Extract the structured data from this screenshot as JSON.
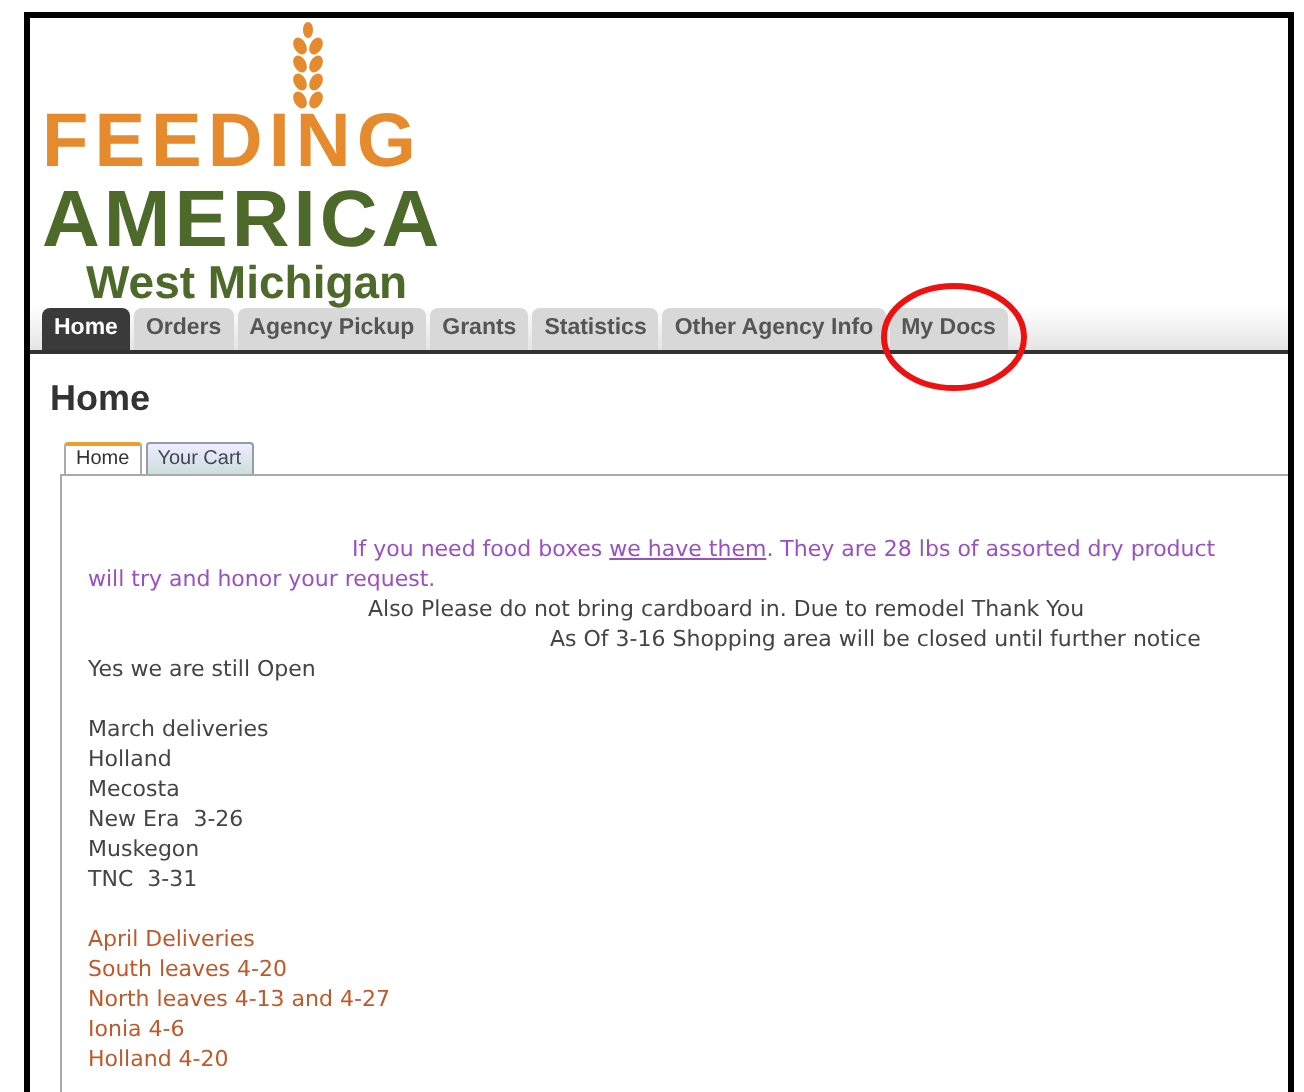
{
  "logo": {
    "line_1": "FEEDING",
    "line_2": "AMERICA",
    "line_3": "West Michigan"
  },
  "nav_tabs": [
    {
      "label": "Home",
      "selected": true
    },
    {
      "label": "Orders",
      "selected": false
    },
    {
      "label": "Agency Pickup",
      "selected": false
    },
    {
      "label": "Grants",
      "selected": false
    },
    {
      "label": "Statistics",
      "selected": false
    },
    {
      "label": "Other Agency Info",
      "selected": false
    },
    {
      "label": "My Docs",
      "selected": false
    }
  ],
  "page_title": "Home",
  "content_tabs": [
    {
      "label": "Home",
      "selected": true
    },
    {
      "label": "Your Cart",
      "selected": false
    }
  ],
  "notice": {
    "before": "If you need food boxes ",
    "link": "we have them",
    "after": ". They are 28 lbs of assorted dry product",
    "color": "#9b4fc4"
  },
  "lines": [
    {
      "text": "will try and honor your request.",
      "color": "#9b4fc4"
    },
    {
      "text": "Also Please do not bring cardboard in. Due to remodel Thank You",
      "color": "#444444"
    },
    {
      "text": "As Of 3-16 Shopping area will be closed until further notice",
      "color": "#444444"
    },
    {
      "text": "Yes we are still Open",
      "color": "#444444"
    },
    {
      "text": "March deliveries",
      "color": "#444444"
    },
    {
      "text": "Holland",
      "color": "#444444"
    },
    {
      "text": "Mecosta",
      "color": "#444444"
    },
    {
      "text": "New Era  3-26",
      "color": "#444444"
    },
    {
      "text": "Muskegon",
      "color": "#444444"
    },
    {
      "text": "TNC  3-31",
      "color": "#444444"
    },
    {
      "text": "April Deliveries",
      "color": "#c0582a"
    },
    {
      "text": "South leaves 4-20",
      "color": "#c0582a"
    },
    {
      "text": "North leaves 4-13 and 4-27",
      "color": "#c0582a"
    },
    {
      "text": "Ionia 4-6",
      "color": "#c0582a"
    },
    {
      "text": "Holland 4-20",
      "color": "#c0582a"
    }
  ]
}
